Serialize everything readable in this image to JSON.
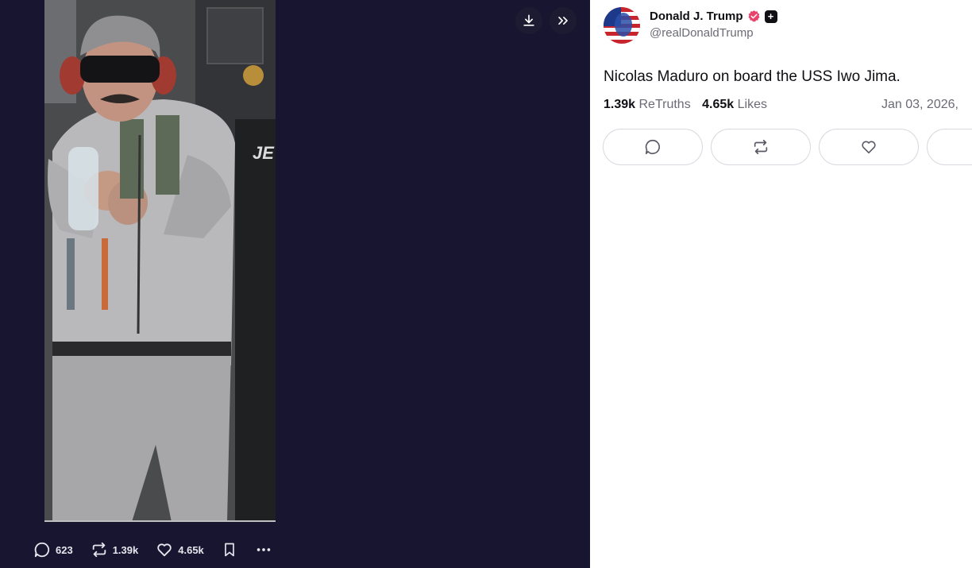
{
  "viewer": {
    "image_description": "photo",
    "actions": {
      "replies": "623",
      "retruths": "1.39k",
      "likes": "4.65k"
    }
  },
  "post": {
    "author_name": "Donald J. Trump",
    "author_handle": "@realDonaldTrump",
    "text": "Nicolas Maduro on board the USS Iwo Jima.",
    "retruths_count": "1.39k",
    "retruths_label": "ReTruths",
    "likes_count": "4.65k",
    "likes_label": "Likes",
    "date": "Jan 03, 2026,",
    "plus_badge": "+"
  },
  "colors": {
    "viewer_bg": "#17152f",
    "verified": "#e8436b",
    "text": "#0f0f14",
    "muted": "#6b6b76",
    "border": "#d9d9e0"
  },
  "icons": [
    "download-icon",
    "chevrons-right-icon",
    "reply-icon",
    "retruth-icon",
    "like-icon",
    "bookmark-icon",
    "more-icon",
    "verified-icon"
  ]
}
